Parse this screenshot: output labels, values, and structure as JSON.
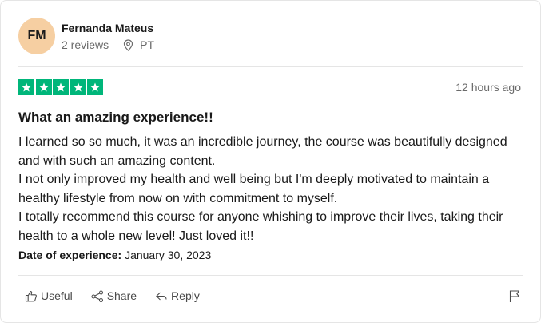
{
  "reviewer": {
    "initials": "FM",
    "name": "Fernanda Mateus",
    "reviews_count": "2 reviews",
    "country": "PT",
    "avatar_color": "#f6cfa2"
  },
  "review": {
    "rating": 5,
    "rating_max": 5,
    "star_color": "#00b67a",
    "time_ago": "12 hours ago",
    "title": "What an amazing experience!!",
    "paragraphs": [
      "I learned so so much, it was an incredible journey, the course was beautifully designed and with such an amazing content.",
      "I not only improved my health and well being but I'm deeply motivated to maintain a healthy lifestyle from now on with commitment to myself.",
      "I totally recommend this course for anyone whishing to improve their lives, taking their health to a whole new level! Just loved it!!"
    ],
    "experience_label": "Date of experience:",
    "experience_date": "January 30, 2023"
  },
  "actions": {
    "useful": "Useful",
    "share": "Share",
    "reply": "Reply"
  },
  "icons": {
    "location": "location-pin-icon",
    "useful": "thumbs-up-icon",
    "share": "share-icon",
    "reply": "reply-icon",
    "report": "flag-icon"
  }
}
